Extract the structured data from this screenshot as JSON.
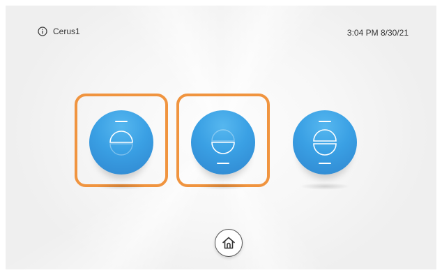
{
  "header": {
    "device_name": "Cerus1",
    "time": "3:04 PM",
    "date": "8/30/21",
    "info_icon": "info-icon"
  },
  "controls": [
    {
      "name": "shade-open",
      "icon": "shade-open-icon",
      "highlighted": true
    },
    {
      "name": "shade-close",
      "icon": "shade-close-icon",
      "highlighted": true
    },
    {
      "name": "shade-stop",
      "icon": "shade-stop-icon",
      "highlighted": false
    }
  ],
  "footer": {
    "home_icon": "home-icon"
  },
  "colors": {
    "button_blue": "#3aa0e4",
    "highlight_orange": "#f0943f",
    "background": "#f7f7f7"
  }
}
